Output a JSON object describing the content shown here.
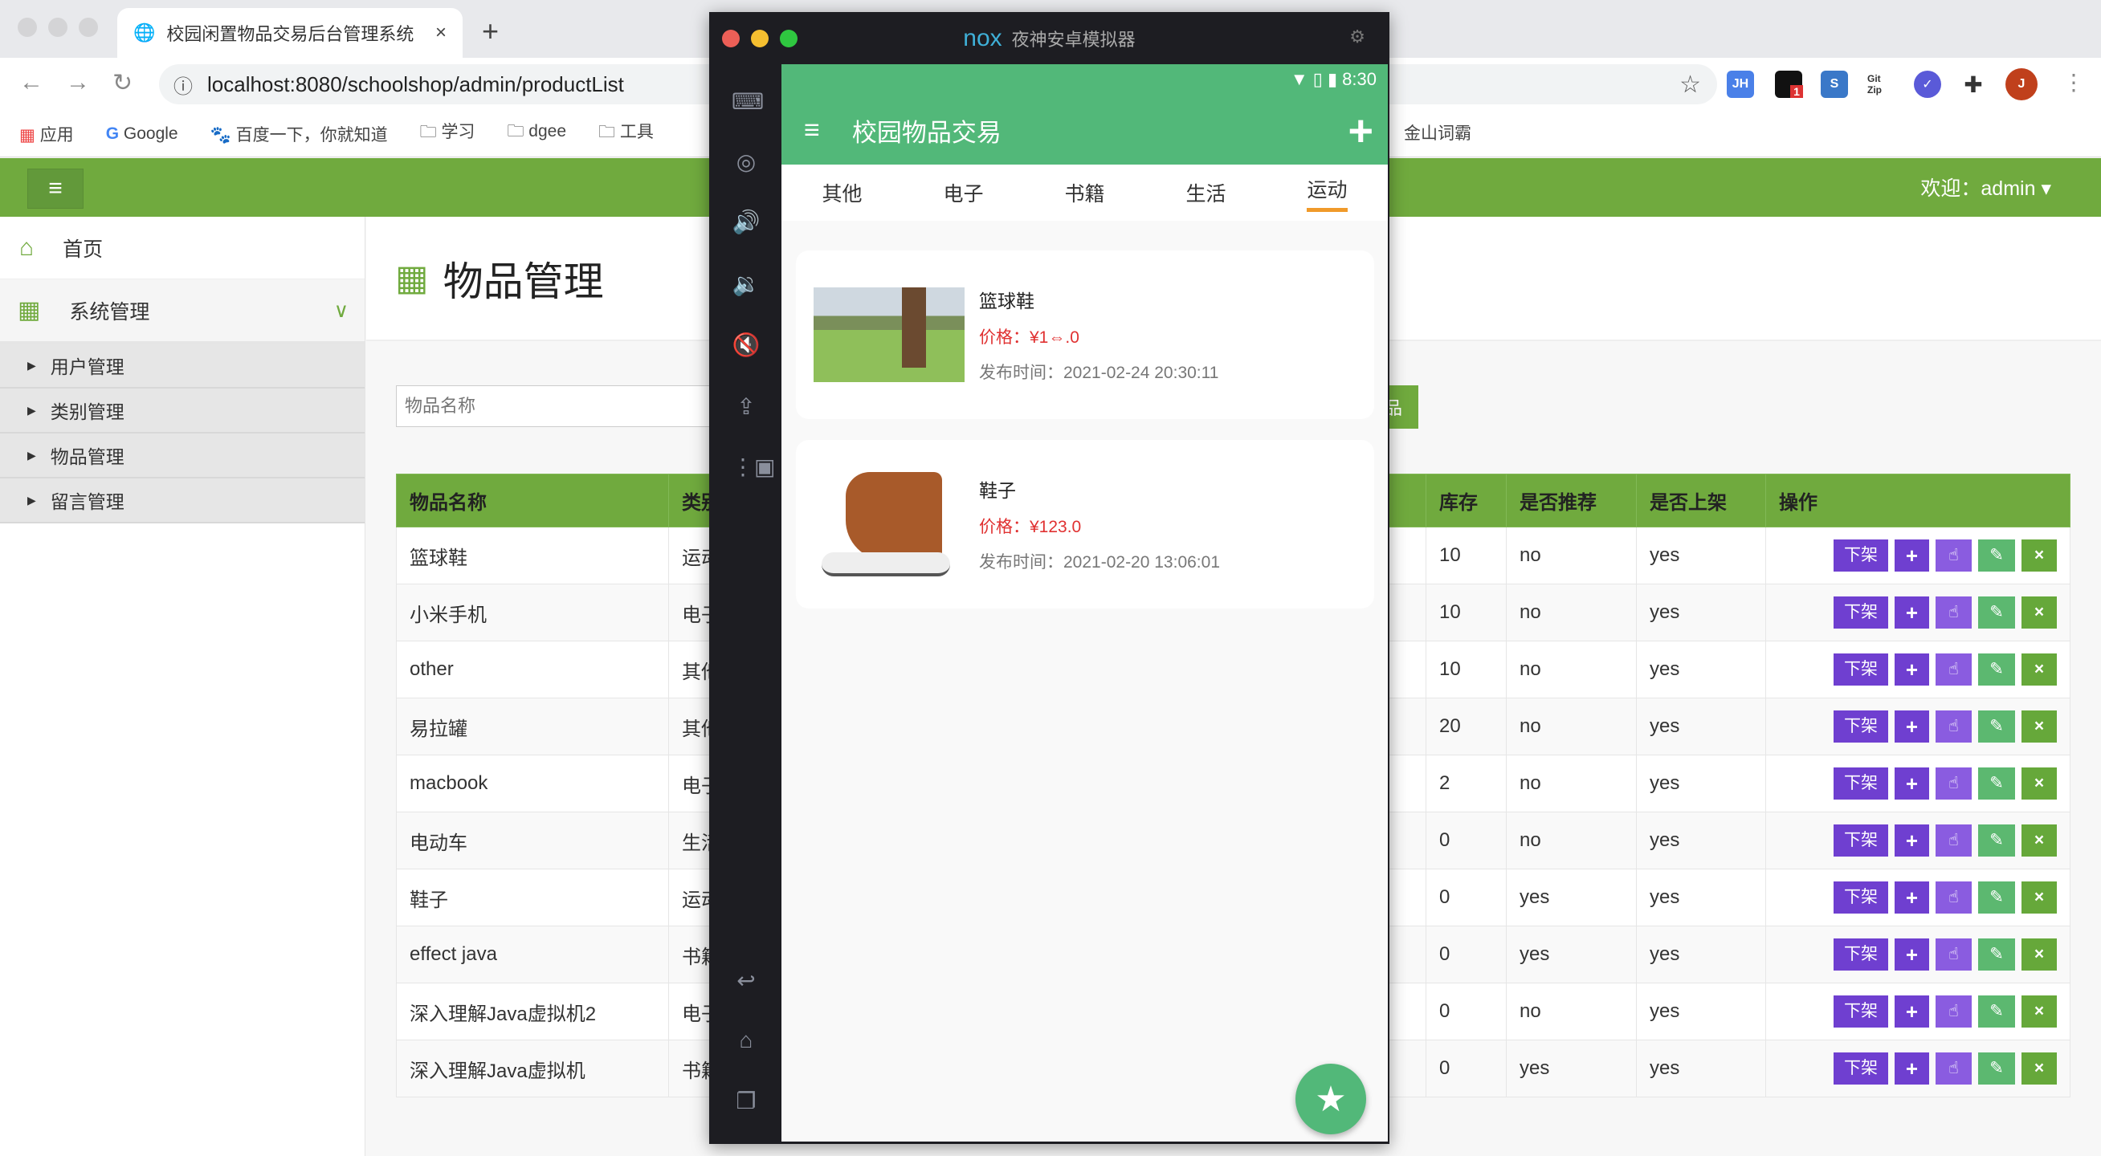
{
  "browser": {
    "tab_title": "校园闲置物品交易后台管理系统",
    "url": "localhost:8080/schoolshop/admin/productList",
    "bookmarks": [
      "应用",
      "Google",
      "百度一下，你就知道",
      "学习",
      "dgee",
      "工具",
      "金山词霸"
    ],
    "extensions": [
      {
        "label": "JH",
        "color": "#4a80e8"
      },
      {
        "label": "1",
        "color": "#111"
      },
      {
        "label": "S",
        "color": "#3a78c8"
      },
      {
        "label": "Git Zip",
        "color": "#fff"
      },
      {
        "label": "✓",
        "color": "#5a5ad8"
      }
    ],
    "profile_initial": "J"
  },
  "header": {
    "welcome": "欢迎：admin",
    "accent": "#70aa3e"
  },
  "sidebar": {
    "home": "首页",
    "group": "系统管理",
    "items": [
      "用户管理",
      "类别管理",
      "物品管理",
      "留言管理"
    ]
  },
  "main": {
    "title": "物品管理",
    "search_placeholder": "物品名称",
    "search_button": "品",
    "columns": [
      "物品名称",
      "类别",
      "库存",
      "是否推荐",
      "是否上架",
      "操作"
    ],
    "rows": [
      {
        "name": "篮球鞋",
        "category": "运动",
        "stock": "10",
        "recommend": "no",
        "listed": "yes"
      },
      {
        "name": "小米手机",
        "category": "电子",
        "stock": "10",
        "recommend": "no",
        "listed": "yes"
      },
      {
        "name": "other",
        "category": "其他",
        "stock": "10",
        "recommend": "no",
        "listed": "yes"
      },
      {
        "name": "易拉罐",
        "category": "其他",
        "stock": "20",
        "recommend": "no",
        "listed": "yes"
      },
      {
        "name": "macbook",
        "category": "电子",
        "stock": "2",
        "recommend": "no",
        "listed": "yes"
      },
      {
        "name": "电动车",
        "category": "生活",
        "stock": "0",
        "recommend": "no",
        "listed": "yes"
      },
      {
        "name": "鞋子",
        "category": "运动",
        "stock": "0",
        "recommend": "yes",
        "listed": "yes"
      },
      {
        "name": "effect java",
        "category": "书籍",
        "stock": "0",
        "recommend": "yes",
        "listed": "yes"
      },
      {
        "name": "深入理解Java虚拟机2",
        "category": "电子",
        "stock": "0",
        "recommend": "no",
        "listed": "yes"
      },
      {
        "name": "深入理解Java虚拟机",
        "category": "书籍",
        "stock": "0",
        "recommend": "yes",
        "listed": "yes"
      }
    ],
    "actions": {
      "off_shelf": "下架",
      "add": "+",
      "edit": "✎",
      "delete": "×"
    }
  },
  "emulator": {
    "logo": "nox",
    "title": "夜神安卓模拟器",
    "time": "8:30",
    "app_title": "校园物品交易",
    "tabs": [
      "其他",
      "电子",
      "书籍",
      "生活",
      "运动"
    ],
    "active_tab": "运动",
    "cards": [
      {
        "name": "篮球鞋",
        "price": "价格：¥1⇔.0",
        "time": "发布时间：2021-02-24 20:30:11"
      },
      {
        "name": "鞋子",
        "price": "价格：¥123.0",
        "time": "发布时间：2021-02-20 13:06:01"
      }
    ],
    "accent": "#52b879"
  }
}
